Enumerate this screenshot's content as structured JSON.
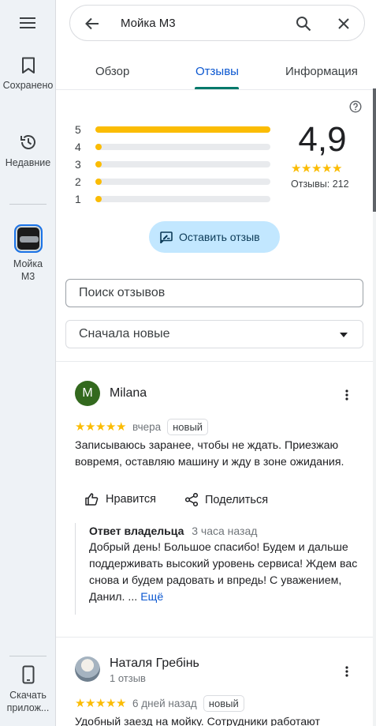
{
  "rail": {
    "menu_icon": "menu-icon",
    "saved_label": "Сохранено",
    "recent_label": "Недавние",
    "place_label": "Мойка М3",
    "download_label": "Скачать прилож..."
  },
  "search": {
    "query": "Мойка М3"
  },
  "tabs": [
    {
      "label": "Обзор"
    },
    {
      "label": "Отзывы"
    },
    {
      "label": "Информация"
    }
  ],
  "rating_summary": {
    "rating": "4,9",
    "count_text": "Отзывы: 212",
    "bars": [
      {
        "stars": "5",
        "fraction": 1.0
      },
      {
        "stars": "4",
        "fraction": 0.03
      },
      {
        "stars": "3",
        "fraction": 0.01
      },
      {
        "stars": "2",
        "fraction": 0.01
      },
      {
        "stars": "1",
        "fraction": 0.03
      }
    ],
    "write_review_label": "Оставить отзыв"
  },
  "review_search": {
    "placeholder": "Поиск отзывов"
  },
  "sort": {
    "selected": "Сначала новые"
  },
  "reviews": [
    {
      "author": "Milana",
      "avatar_letter": "M",
      "stars": 5,
      "when": "вчера",
      "badge": "новый",
      "text": "Записываюсь заранее, чтобы не ждать. Приезжаю вовремя, оставляю машину и жду в зоне ожидания.",
      "like_label": "Нравится",
      "share_label": "Поделиться",
      "owner_reply": {
        "title": "Ответ владельца",
        "ago": "3 часа назад",
        "text": "Добрый день! Большое спасибо! Будем и дальше поддерживать высокий уровень сервиса! Ждем вас снова и будем радовать и впредь! С уважением, Данил. ...",
        "more_label": "Ещё"
      }
    },
    {
      "author": "Наталя Гребінь",
      "subtitle": "1 отзыв",
      "stars": 5,
      "when": "6 дней назад",
      "badge": "новый",
      "text": "Удобный заезд на мойку. Сотрудники работают"
    }
  ],
  "colors": {
    "accent": "#0b57d0",
    "tab_indicator": "#00796b",
    "star": "#fbbc04",
    "write_button_bg": "#c2e7ff",
    "avatar_green": "#33691e"
  }
}
